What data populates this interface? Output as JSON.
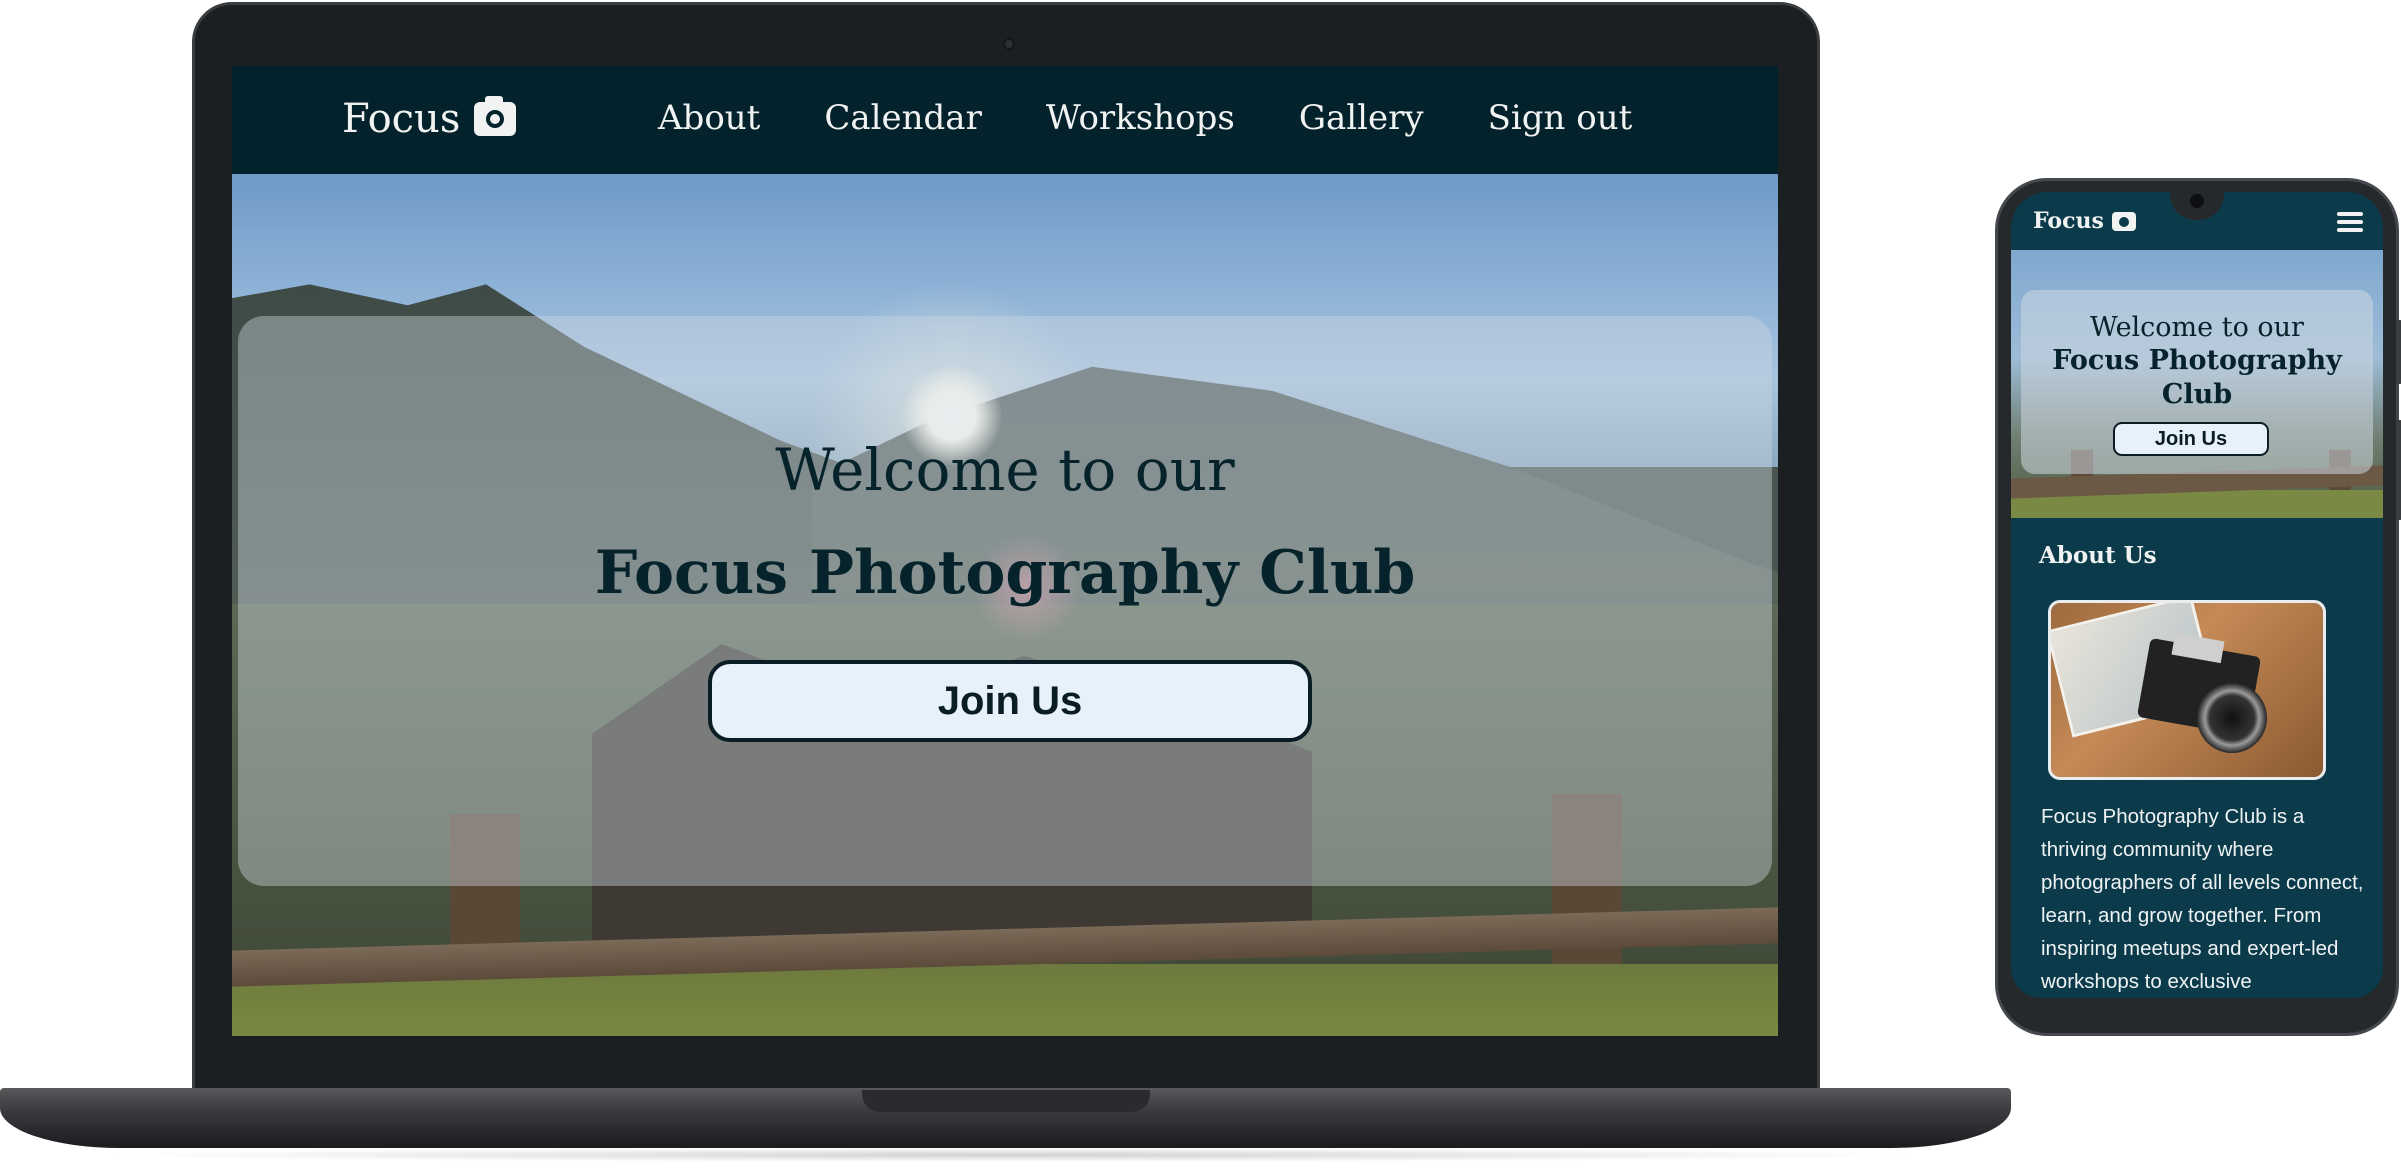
{
  "desktop": {
    "brand": "Focus",
    "nav": [
      "About",
      "Calendar",
      "Workshops",
      "Gallery",
      "Sign out"
    ],
    "hero": {
      "line1": "Welcome to our",
      "line2": "Focus Photography Club",
      "cta": "Join Us"
    }
  },
  "mobile": {
    "brand": "Focus",
    "hero": {
      "line1": "Welcome to our",
      "line2": "Focus Photography Club",
      "cta": "Join Us"
    },
    "about": {
      "title": "About Us",
      "text": "Focus Photography Club is a thriving community where photographers of all levels connect, learn, and grow together. From inspiring meetups and expert-led workshops to exclusive"
    }
  },
  "icons": {
    "brand": "camera-icon",
    "menu": "hamburger-menu-icon"
  },
  "colors": {
    "nav_bg": "#04222c",
    "mobile_bg": "#0b3a4a",
    "button_bg": "#e6f1fa",
    "text_dark": "#06232b"
  }
}
